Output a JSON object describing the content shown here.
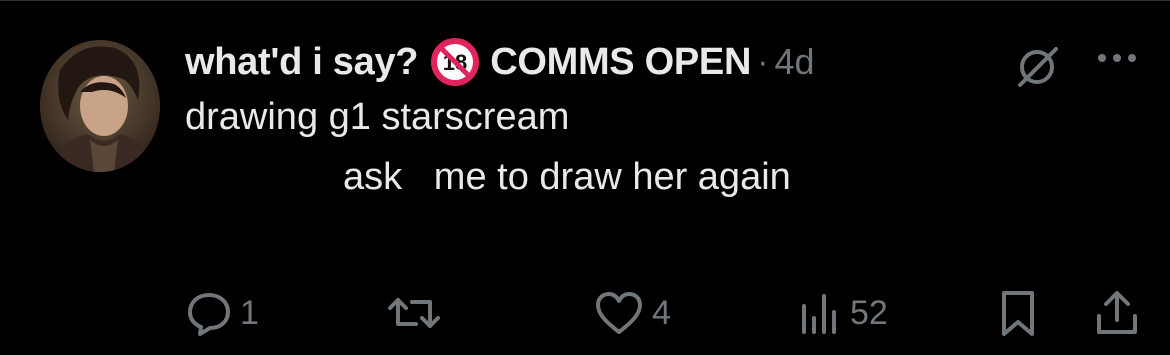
{
  "post": {
    "display_name": "what'd i say?",
    "badge_icon": "adult-content-18-icon",
    "display_name_suffix": "COMMS OPEN",
    "separator": "·",
    "timestamp": "4d",
    "text_line1": "drawing g1 starscream",
    "text_line2": "ask   me to draw her again"
  },
  "actions": {
    "replies": "1",
    "likes": "4",
    "views": "52"
  },
  "colors": {
    "background": "#000000",
    "text": "#e7e9ea",
    "muted": "#71767b",
    "badge_red": "#e0245e"
  }
}
